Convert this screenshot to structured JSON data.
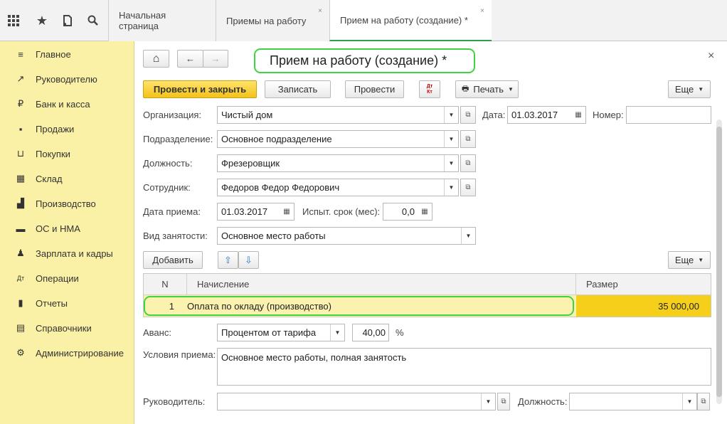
{
  "topbar": {
    "icons": [
      "apps-grid-icon",
      "star-icon",
      "history-icon",
      "search-icon"
    ],
    "tabs": [
      {
        "label": "Начальная страница"
      },
      {
        "label": "Приемы на работу",
        "close": "×"
      },
      {
        "label": "Прием на работу (создание) *",
        "close": "×"
      }
    ]
  },
  "sidebar": {
    "items": [
      {
        "label": "Главное",
        "icon": "menu-icon",
        "glyph": "≡"
      },
      {
        "label": "Руководителю",
        "icon": "trend-icon",
        "glyph": "↗"
      },
      {
        "label": "Банк и касса",
        "icon": "ruble-icon",
        "glyph": "₽"
      },
      {
        "label": "Продажи",
        "icon": "bag-icon",
        "glyph": "▪"
      },
      {
        "label": "Покупки",
        "icon": "cart-icon",
        "glyph": "⊔"
      },
      {
        "label": "Склад",
        "icon": "warehouse-icon",
        "glyph": "▦"
      },
      {
        "label": "Производство",
        "icon": "factory-icon",
        "glyph": "▟"
      },
      {
        "label": "ОС и НМА",
        "icon": "truck-icon",
        "glyph": "▬"
      },
      {
        "label": "Зарплата и кадры",
        "icon": "people-icon",
        "glyph": "♟"
      },
      {
        "label": "Операции",
        "icon": "dt-kt-icon",
        "glyph": "Дт"
      },
      {
        "label": "Отчеты",
        "icon": "bar-chart-icon",
        "glyph": "▮"
      },
      {
        "label": "Справочники",
        "icon": "book-icon",
        "glyph": "▤"
      },
      {
        "label": "Администрирование",
        "icon": "gear-icon",
        "glyph": "⚙"
      }
    ]
  },
  "form": {
    "title": "Прием на работу (создание) *",
    "close": "×",
    "nav": {
      "home": "⌂",
      "back": "←",
      "forward": "→"
    },
    "toolbar": {
      "post_close": "Провести и закрыть",
      "save": "Записать",
      "post": "Провести",
      "dtkt": "Дт Кт",
      "print": "Печать",
      "more": "Еще"
    },
    "fields": {
      "org_label": "Организация:",
      "org_value": "Чистый дом",
      "date_label": "Дата:",
      "date_value": "01.03.2017",
      "number_label": "Номер:",
      "number_value": "",
      "division_label": "Подразделение:",
      "division_value": "Основное подразделение",
      "position_label": "Должность:",
      "position_value": "Фрезеровщик",
      "employee_label": "Сотрудник:",
      "employee_value": "Федоров Федор Федорович",
      "hire_date_label": "Дата приема:",
      "hire_date_value": "01.03.2017",
      "trial_label": "Испыт. срок (мес):",
      "trial_value": "0,0",
      "employment_label": "Вид занятости:",
      "employment_value": "Основное место работы",
      "advance_label": "Аванс:",
      "advance_mode": "Процентом от тарифа",
      "advance_value": "40,00",
      "advance_unit": "%",
      "conditions_label": "Условия приема:",
      "conditions_value": "Основное место работы, полная занятость",
      "manager_label": "Руководитель:",
      "manager_value": "",
      "manager_position_label": "Должность:",
      "manager_position_value": ""
    },
    "table_toolbar": {
      "add": "Добавить",
      "up": "⇧",
      "down": "⇩",
      "more": "Еще"
    },
    "table": {
      "headers": [
        "N",
        "Начисление",
        "Размер"
      ],
      "rows": [
        {
          "n": "1",
          "accrual": "Оплата по окладу (производство)",
          "amount": "35 000,00"
        }
      ]
    }
  }
}
